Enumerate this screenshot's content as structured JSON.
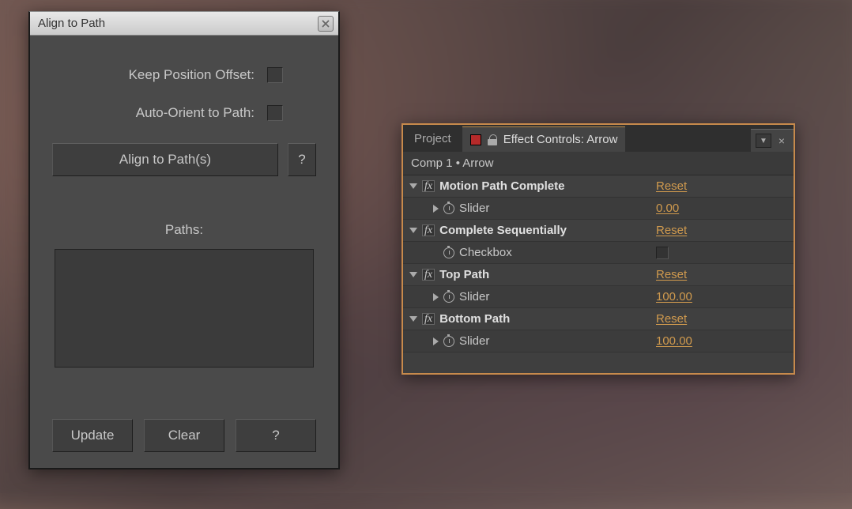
{
  "align_panel": {
    "title": "Align to Path",
    "keep_offset_label": "Keep Position Offset:",
    "auto_orient_label": "Auto-Orient to Path:",
    "align_button": "Align to Path(s)",
    "help": "?",
    "paths_label": "Paths:",
    "update_button": "Update",
    "clear_button": "Clear"
  },
  "effect_controls": {
    "tab_inactive": "Project",
    "tab_active": "Effect Controls: Arrow",
    "breadcrumb": "Comp 1 • Arrow",
    "reset_label": "Reset",
    "effects": [
      {
        "name": "Motion Path Complete",
        "prop_label": "Slider",
        "value": "0.00",
        "type": "slider"
      },
      {
        "name": "Complete Sequentially",
        "prop_label": "Checkbox",
        "value": "",
        "type": "checkbox"
      },
      {
        "name": "Top Path",
        "prop_label": "Slider",
        "value": "100.00",
        "type": "slider"
      },
      {
        "name": "Bottom Path",
        "prop_label": "Slider",
        "value": "100.00",
        "type": "slider"
      }
    ]
  }
}
